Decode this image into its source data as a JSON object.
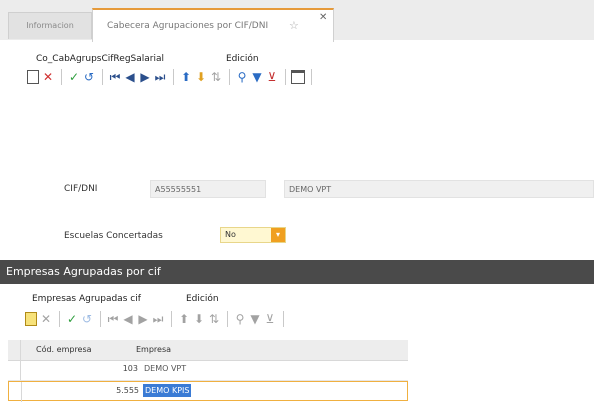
{
  "tabs": {
    "inactive_label": "Informacion",
    "active_label": "Cabecera Agrupaciones por CIF/DNI"
  },
  "top_menu": {
    "item1": "Co_CabAgrupsCifRegSalarial",
    "item2": "Edición"
  },
  "form": {
    "cif_label": "CIF/DNI",
    "cif_value": "A55555551",
    "name_value": "DEMO VPT",
    "escuelas_label": "Escuelas Concertadas",
    "escuelas_value": "No"
  },
  "section": {
    "title": "Empresas Agrupadas por cif"
  },
  "sub_menu": {
    "item1": "Empresas Agrupadas cif",
    "item2": "Edición"
  },
  "grid": {
    "col_code": "Cód. empresa",
    "col_name": "Empresa",
    "rows": [
      {
        "code": "103",
        "name": "DEMO VPT"
      },
      {
        "code": "5.555",
        "name": "DEMO KPIS"
      }
    ]
  },
  "colors": {
    "accent_tab": "#e69a3a",
    "section_bg": "#4a4a4a",
    "select_bg": "#fff8d2",
    "row_highlight": "#3a7bd5"
  }
}
